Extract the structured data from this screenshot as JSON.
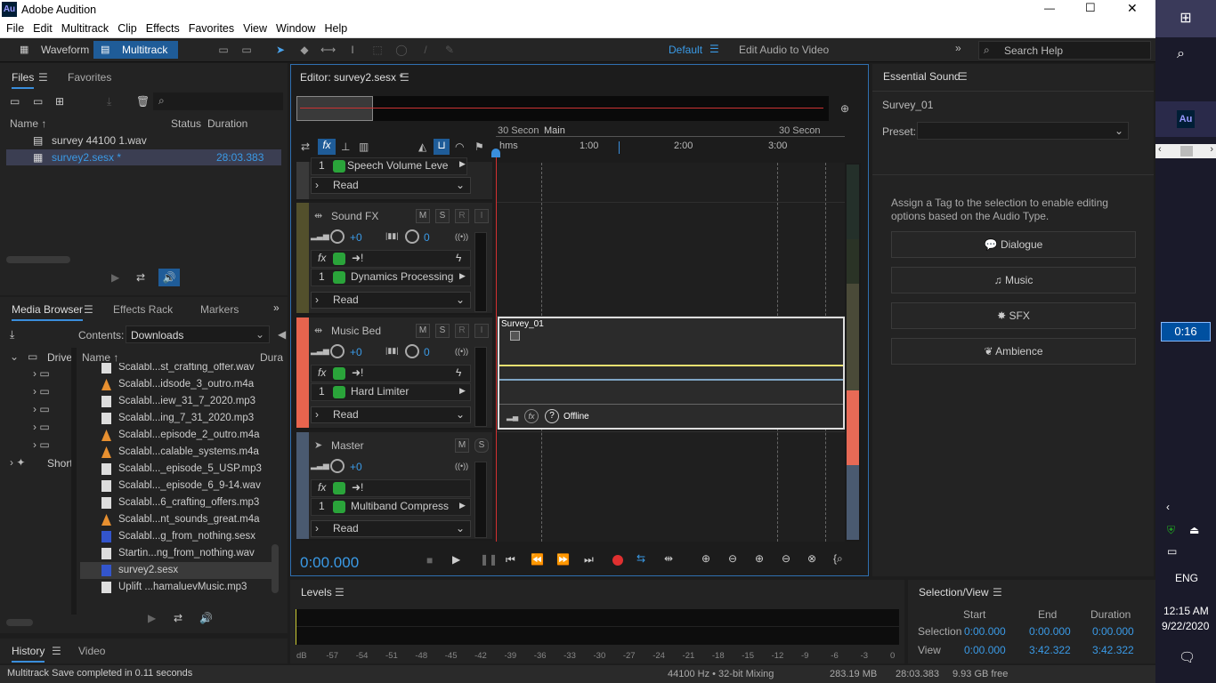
{
  "window": {
    "app_icon": "Au",
    "title": "Adobe Audition",
    "minimize": "—",
    "maximize": "☐",
    "close": "✕"
  },
  "menu": [
    "File",
    "Edit",
    "Multitrack",
    "Clip",
    "Effects",
    "Favorites",
    "View",
    "Window",
    "Help"
  ],
  "toolbar": {
    "waveform": "Waveform",
    "multitrack": "Multitrack",
    "workspace": "Default",
    "edit_audio_video": "Edit Audio to Video",
    "search_placeholder": "Search Help"
  },
  "files_panel": {
    "tabs": [
      "Files",
      "Favorites"
    ],
    "columns": {
      "name": "Name ↑",
      "status": "Status",
      "duration": "Duration"
    },
    "rows": [
      {
        "name": "survey 44100 1.wav",
        "duration": ""
      },
      {
        "name": "survey2.sesx *",
        "duration": "28:03.383"
      }
    ]
  },
  "media_browser": {
    "tabs": [
      "Media Browser",
      "Effects Rack",
      "Markers"
    ],
    "contents_label": "Contents:",
    "contents_value": "Downloads",
    "tree": [
      "Drive",
      "Short"
    ],
    "name_col": "Name ↑",
    "dur_col": "Dura",
    "files": [
      {
        "name": "Scalabl...st_crafting_offer.wav",
        "type": "wav"
      },
      {
        "name": "Scalabl...idsode_3_outro.m4a",
        "type": "m4a"
      },
      {
        "name": "Scalabl...iew_31_7_2020.mp3",
        "type": "mp3"
      },
      {
        "name": "Scalabl...ing_7_31_2020.mp3",
        "type": "mp3"
      },
      {
        "name": "Scalabl...episode_2_outro.m4a",
        "type": "m4a"
      },
      {
        "name": "Scalabl...calable_systems.m4a",
        "type": "m4a"
      },
      {
        "name": "Scalabl..._episode_5_USP.mp3",
        "type": "mp3"
      },
      {
        "name": "Scalabl..._episode_6_9-14.wav",
        "type": "wav"
      },
      {
        "name": "Scalabl...6_crafting_offers.mp3",
        "type": "mp3"
      },
      {
        "name": "Scalabl...nt_sounds_great.m4a",
        "type": "m4a"
      },
      {
        "name": "Scalabl...g_from_nothing.sesx",
        "type": "sesx"
      },
      {
        "name": "Startin...ng_from_nothing.wav",
        "type": "wav"
      },
      {
        "name": "survey2.sesx",
        "type": "sesx"
      },
      {
        "name": "Uplift ...hamaluevMusic.mp3",
        "type": "mp3"
      }
    ]
  },
  "history": {
    "tabs": [
      "History",
      "Video"
    ],
    "status": "Multitrack Save completed in 0.11 seconds"
  },
  "editor": {
    "title": "Editor: survey2.sesx *",
    "ruler_labels": [
      "hms",
      "1:00",
      "2:00",
      "3:00"
    ],
    "markers": [
      "30 Secon",
      "Main",
      "30 Secon"
    ],
    "tracks": [
      {
        "name": "",
        "effect": "Speech Volume Leve",
        "read": "Read"
      },
      {
        "name": "Sound FX",
        "vol": "+0",
        "pan": "0",
        "effect": "Dynamics Processing",
        "read": "Read"
      },
      {
        "name": "Music Bed",
        "vol": "+0",
        "pan": "0",
        "effect": "Hard Limiter",
        "read": "Read"
      },
      {
        "name": "Master",
        "vol": "+0",
        "effect": "Multiband Compress",
        "read": "Read"
      }
    ],
    "buttons": {
      "m": "M",
      "s": "S",
      "r": "R",
      "i": "I"
    },
    "clip": {
      "name": "Survey_01",
      "status": "Offline"
    },
    "time": "0:00.000",
    "fx_slot": "1"
  },
  "essential_sound": {
    "title": "Essential Sound",
    "clip": "Survey_01",
    "preset_label": "Preset:",
    "hint": "Assign a Tag to the selection to enable editing options based on the Audio Type.",
    "buttons": [
      "Dialogue",
      "Music",
      "SFX",
      "Ambience"
    ]
  },
  "levels": {
    "title": "Levels",
    "scale": [
      "dB",
      "-57",
      "-54",
      "-51",
      "-48",
      "-45",
      "-42",
      "-39",
      "-36",
      "-33",
      "-30",
      "-27",
      "-24",
      "-21",
      "-18",
      "-15",
      "-12",
      "-9",
      "-6",
      "-3",
      "0"
    ]
  },
  "selection_view": {
    "title": "Selection/View",
    "headers": [
      "Start",
      "End",
      "Duration"
    ],
    "rows": [
      {
        "label": "Selection",
        "start": "0:00.000",
        "end": "0:00.000",
        "duration": "0:00.000"
      },
      {
        "label": "View",
        "start": "0:00.000",
        "end": "3:42.322",
        "duration": "3:42.322"
      }
    ]
  },
  "statusbar": {
    "sample": "44100 Hz • 32-bit Mixing",
    "mem": "283.19 MB",
    "dur": "28:03.383",
    "disk": "9.93 GB free"
  },
  "taskbar": {
    "timer": "0:16",
    "lang": "ENG",
    "time": "12:15 AM",
    "date": "9/22/2020"
  }
}
